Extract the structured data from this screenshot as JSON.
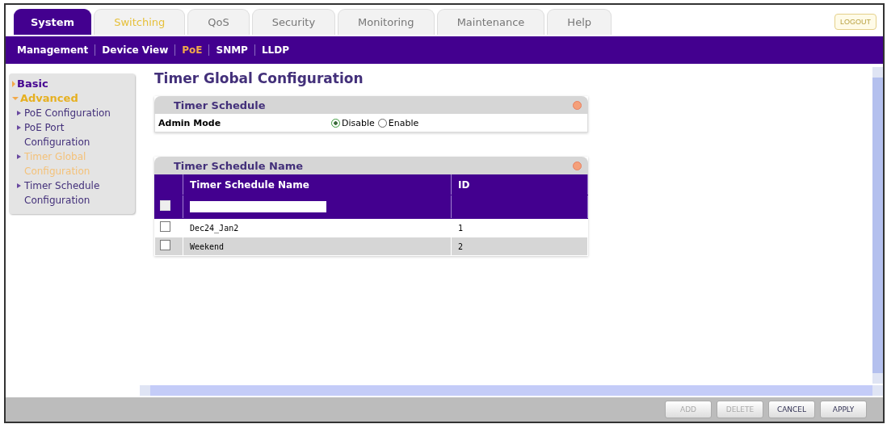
{
  "tabs": [
    {
      "label": "System",
      "selected": true,
      "highlighted": false
    },
    {
      "label": "Switching",
      "selected": false,
      "highlighted": true
    },
    {
      "label": "QoS",
      "selected": false,
      "highlighted": false
    },
    {
      "label": "Security",
      "selected": false,
      "highlighted": false
    },
    {
      "label": "Monitoring",
      "selected": false,
      "highlighted": false
    },
    {
      "label": "Maintenance",
      "selected": false,
      "highlighted": false
    },
    {
      "label": "Help",
      "selected": false,
      "highlighted": false
    }
  ],
  "logout": "LOGOUT",
  "subnav": [
    {
      "label": "Management",
      "selected": false
    },
    {
      "label": "Device View",
      "selected": false
    },
    {
      "label": "PoE",
      "selected": true
    },
    {
      "label": "SNMP",
      "selected": false
    },
    {
      "label": "LLDP",
      "selected": false
    }
  ],
  "sidebar": {
    "items": [
      {
        "label": "Basic",
        "expanded": false
      },
      {
        "label": "Advanced",
        "expanded": true,
        "children": [
          {
            "label": "PoE Configuration",
            "selected": false
          },
          {
            "label": "PoE Port Configuration",
            "selected": false
          },
          {
            "label": "Timer Global Configuration",
            "selected": true
          },
          {
            "label": "Timer Schedule Configuration",
            "selected": false
          }
        ]
      }
    ]
  },
  "page_title": "Timer Global Configuration",
  "schedule_panel": {
    "title": "Timer Schedule",
    "field_label": "Admin Mode",
    "options": [
      {
        "label": "Disable",
        "selected": true
      },
      {
        "label": "Enable",
        "selected": false
      }
    ]
  },
  "name_panel": {
    "title": "Timer Schedule Name",
    "columns": [
      "Timer Schedule Name",
      "ID"
    ],
    "new_row": {
      "checked": false
    },
    "rows": [
      {
        "checked": false,
        "name": "Dec24_Jan2",
        "id": "1"
      },
      {
        "checked": false,
        "name": "Weekend",
        "id": "2"
      }
    ]
  },
  "buttons": [
    {
      "label": "ADD",
      "disabled": true
    },
    {
      "label": "DELETE",
      "disabled": true
    },
    {
      "label": "CANCEL",
      "disabled": false
    },
    {
      "label": "APPLY",
      "disabled": false
    }
  ]
}
